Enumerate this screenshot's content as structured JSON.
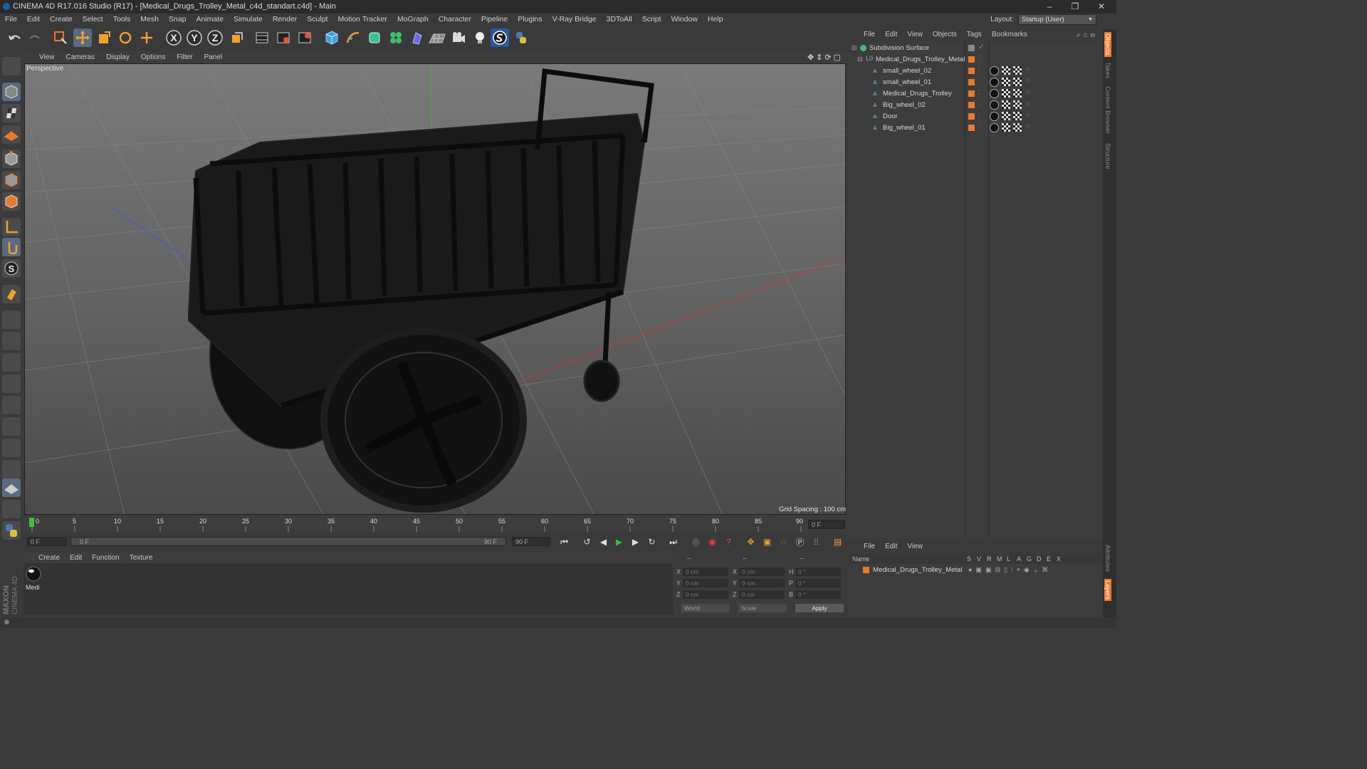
{
  "window": {
    "title": "CINEMA 4D R17.016 Studio (R17) - [Medical_Drugs_Trolley_Metal_c4d_standart.c4d] - Main",
    "controls": [
      "–",
      "❐",
      "✕"
    ]
  },
  "menubar": {
    "items": [
      "File",
      "Edit",
      "Create",
      "Select",
      "Tools",
      "Mesh",
      "Snap",
      "Animate",
      "Simulate",
      "Render",
      "Sculpt",
      "Motion Tracker",
      "MoGraph",
      "Character",
      "Pipeline",
      "Plugins",
      "V-Ray Bridge",
      "3DToAll",
      "Script",
      "Window",
      "Help"
    ],
    "layout_label": "Layout:",
    "layout_value": "Startup (User)"
  },
  "toolbar": {
    "icons": [
      "undo-icon",
      "redo-icon",
      "live-select-icon",
      "move-icon",
      "scale-icon",
      "rotate-icon",
      "create-move-icon",
      "x-axis-icon",
      "y-axis-icon",
      "z-axis-icon",
      "world-coords-icon",
      "render-view-icon",
      "render-picture-viewer-icon",
      "render-settings-icon",
      "cube-icon",
      "pen-icon",
      "subdivision-icon",
      "cloner-icon",
      "deformer-icon",
      "floor-icon",
      "camera-icon",
      "light-icon",
      "sketch-icon",
      "python-icon"
    ],
    "axis_labels": [
      "X",
      "Y",
      "Z"
    ]
  },
  "viewport": {
    "menu": [
      "View",
      "Cameras",
      "Display",
      "Options",
      "Filter",
      "Panel"
    ],
    "label": "Perspective",
    "grid_spacing": "Grid Spacing : 100 cm"
  },
  "timeline": {
    "ticks": [
      "0",
      "5",
      "10",
      "15",
      "20",
      "25",
      "30",
      "35",
      "40",
      "45",
      "50",
      "55",
      "60",
      "65",
      "70",
      "75",
      "80",
      "85",
      "90"
    ],
    "current_frame": "0 F",
    "start_field": "0 F",
    "range_start": "0 F",
    "range_end": "90 F",
    "end_field": "90 F"
  },
  "material_manager": {
    "menu": [
      "Create",
      "Edit",
      "Function",
      "Texture"
    ],
    "materials": [
      {
        "name": "Medi"
      }
    ]
  },
  "coordinates": {
    "header": [
      "--",
      "--",
      "--"
    ],
    "rows": [
      {
        "a": "X",
        "av": "0 cm",
        "b": "X",
        "bv": "0 cm",
        "c": "H",
        "cv": "0 °"
      },
      {
        "a": "Y",
        "av": "0 cm",
        "b": "Y",
        "bv": "0 cm",
        "c": "P",
        "cv": "0 °"
      },
      {
        "a": "Z",
        "av": "0 cm",
        "b": "Z",
        "bv": "0 cm",
        "c": "B",
        "cv": "0 °"
      }
    ],
    "mode": "World",
    "scale": "Scale",
    "apply": "Apply"
  },
  "object_manager": {
    "menu": [
      "File",
      "Edit",
      "View",
      "Objects",
      "Tags",
      "Bookmarks"
    ],
    "objects": [
      {
        "name": "Subdivision Surface",
        "level": 0
      },
      {
        "name": "Medical_Drugs_Trolley_Metal",
        "level": 1
      },
      {
        "name": "small_wheel_02",
        "level": 2
      },
      {
        "name": "small_wheel_01",
        "level": 2
      },
      {
        "name": "Medical_Drugs_Trolley",
        "level": 2
      },
      {
        "name": "Big_wheel_02",
        "level": 2
      },
      {
        "name": "Door",
        "level": 2
      },
      {
        "name": "Big_wheel_01",
        "level": 2
      }
    ]
  },
  "attribute_manager": {
    "menu": [
      "File",
      "Edit",
      "View"
    ],
    "columns": [
      "Name",
      "S",
      "V",
      "R",
      "M",
      "L",
      "A",
      "G",
      "D",
      "E",
      "X"
    ],
    "rows": [
      {
        "name": "Medical_Drugs_Trolley_Metal"
      }
    ]
  },
  "side_tabs": [
    "Objects",
    "Takes",
    "Content Browser",
    "Structure",
    "Attributes",
    "Layers"
  ],
  "brand": {
    "line1": "MAXON",
    "line2": "CINEMA 4D"
  },
  "colors": {
    "accent_orange": "#e87a2d",
    "axis_x": "#c8393a",
    "axis_y": "#3fae3f",
    "axis_z": "#3a5fc8",
    "play_green": "#2fbf3f"
  }
}
